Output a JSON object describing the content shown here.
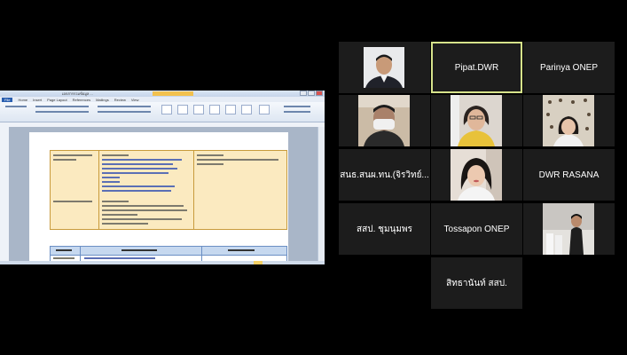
{
  "word_window": {
    "title": "เอกสารรวมข้อมูล ...",
    "menu": [
      "File",
      "Home",
      "Insert",
      "Page Layout",
      "References",
      "Mailings",
      "Review",
      "View"
    ]
  },
  "participants": [
    {
      "id": "p1",
      "name": "",
      "has_video": true
    },
    {
      "id": "p2",
      "name": "Pipat.DWR",
      "active": true
    },
    {
      "id": "p3",
      "name": "Parinya ONEP"
    },
    {
      "id": "p4",
      "name": "",
      "has_video": true
    },
    {
      "id": "p5",
      "name": "",
      "has_video": true
    },
    {
      "id": "p6",
      "name": "",
      "has_video": true
    },
    {
      "id": "p7",
      "name": "สนธ.สนผ.ทน.(จิรวิทย์..."
    },
    {
      "id": "p8",
      "name": "",
      "has_video": true
    },
    {
      "id": "p9",
      "name": "DWR RASANA"
    },
    {
      "id": "p10",
      "name": "สสป. ชุมนุมพร"
    },
    {
      "id": "p11",
      "name": "Tossapon ONEP"
    },
    {
      "id": "p12",
      "name": "",
      "has_video": true
    },
    {
      "id": "p13",
      "name": "สิทธานันท์ สสป."
    }
  ],
  "colors": {
    "background": "#000000",
    "tile": "#1c1c1c",
    "active_border": "#d6e28a"
  }
}
